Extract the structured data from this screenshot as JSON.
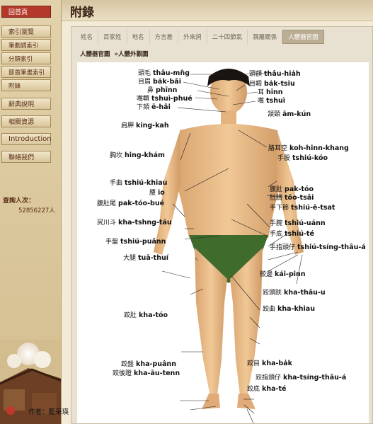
{
  "sidebar": {
    "home": "回首頁",
    "items": [
      {
        "label": "索引瀏覽",
        "small": false
      },
      {
        "label": "筆劃調索引",
        "small": true
      },
      {
        "label": "分類索引",
        "small": true
      },
      {
        "label": "部首筆畫索引",
        "small": true
      },
      {
        "label": "附錄",
        "small": true
      },
      {
        "label": "辭典說明",
        "small": false
      },
      {
        "label": "相關資源",
        "small": false
      },
      {
        "label": "Introduction",
        "small": false
      },
      {
        "label": "聯絡我們",
        "small": false
      }
    ],
    "counter_label": "查詢人次：",
    "counter_value": "52856227人"
  },
  "header": {
    "title": "附錄"
  },
  "tabs": [
    "姓名",
    "百家姓",
    "地名",
    "方言差",
    "外來詞",
    "二十四節氣",
    "親屬關係",
    "人體器官圖"
  ],
  "active_tab": 7,
  "breadcrumb": [
    "人體器官圖",
    "»人體外觀圖"
  ],
  "author": "作者：藍采瑛",
  "labels_left": [
    {
      "zh": "頭毛",
      "rom": "thâu-mn̂g"
    },
    {
      "zh": "目眉",
      "rom": "ba̍k-bâi"
    },
    {
      "zh": "鼻",
      "rom": "phīnn"
    },
    {
      "zh": "嘴䫌",
      "rom": "tshuì-phué"
    },
    {
      "zh": "下頦",
      "rom": "ē-hâi"
    },
    {
      "zh": "肩胛",
      "rom": "king-kah"
    },
    {
      "zh": "胸坎",
      "rom": "hing-khám"
    },
    {
      "zh": "手曲",
      "rom": "tshiú-khiau"
    },
    {
      "zh": "腰",
      "rom": "io"
    },
    {
      "zh": "腹肚尾",
      "rom": "pak-tóo-bué"
    },
    {
      "zh": "尻川斗",
      "rom": "kha-tshng-táu"
    },
    {
      "zh": "手盤",
      "rom": "tshiú-puânn"
    },
    {
      "zh": "大腿",
      "rom": "tuā-thuí"
    },
    {
      "zh": "跤肚",
      "rom": "kha-tóo"
    },
    {
      "zh": "跤盤",
      "rom": "kha-puânn"
    },
    {
      "zh": "跤後蹬",
      "rom": "kha-āu-tenn"
    }
  ],
  "labels_right": [
    {
      "zh": "頭額",
      "rom": "thâu-hia̍h"
    },
    {
      "zh": "目睭",
      "rom": "ba̍k-tsiu"
    },
    {
      "zh": "耳",
      "rom": "hīnn"
    },
    {
      "zh": "嘴",
      "rom": "tshuì"
    },
    {
      "zh": "頷頸",
      "rom": "ām-kún"
    },
    {
      "zh": "胳耳空",
      "rom": "koh-hinn-khang"
    },
    {
      "zh": "手股",
      "rom": "tshiú-kóo"
    },
    {
      "zh": "腹肚",
      "rom": "pak-tóo"
    },
    {
      "zh": "肚臍",
      "rom": "tōo-tsâi"
    },
    {
      "zh": "手下節",
      "rom": "tshiú-ē-tsat"
    },
    {
      "zh": "手腕",
      "rom": "tshiú-uánn"
    },
    {
      "zh": "手底",
      "rom": "tshiú-té"
    },
    {
      "zh": "手指頭仔",
      "rom": "tshiú-tsíng-thâu-á"
    },
    {
      "zh": "骹邊",
      "rom": "kái-pinn"
    },
    {
      "zh": "跤頭趺",
      "rom": "kha-thâu-u"
    },
    {
      "zh": "跤曲",
      "rom": "kha-khiau"
    },
    {
      "zh": "跤目",
      "rom": "kha-ba̍k"
    },
    {
      "zh": "跤指頭仔",
      "rom": "kha-tsíng-thâu-á"
    },
    {
      "zh": "跤底",
      "rom": "kha-té"
    }
  ]
}
